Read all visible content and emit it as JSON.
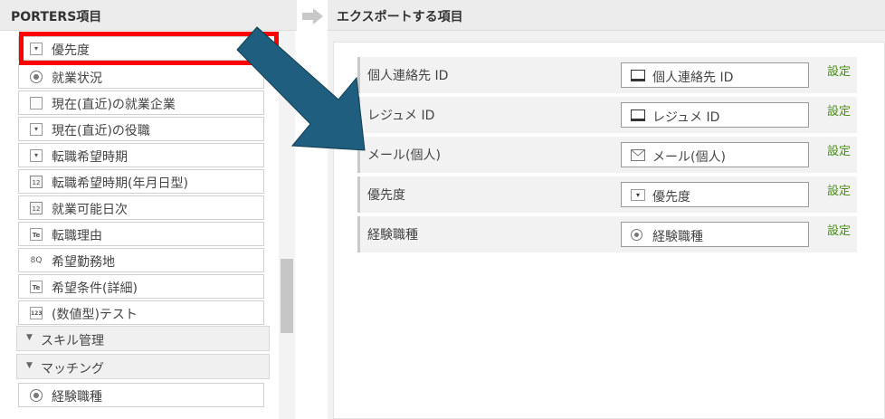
{
  "left_panel": {
    "title": "PORTERS項目",
    "items": [
      {
        "label": "優先度",
        "icon": "dropdown-icon"
      },
      {
        "label": "就業状況",
        "icon": "radio-icon"
      },
      {
        "label": "現在(直近)の就業企業",
        "icon": "document-icon"
      },
      {
        "label": "現在(直近)の役職",
        "icon": "dropdown-icon"
      },
      {
        "label": "転職希望時期",
        "icon": "dropdown-icon"
      },
      {
        "label": "転職希望時期(年月日型)",
        "icon": "calendar-icon"
      },
      {
        "label": "就業可能日次",
        "icon": "calendar-icon"
      },
      {
        "label": "転職理由",
        "icon": "textarea-icon"
      },
      {
        "label": "希望勤務地",
        "icon": "location-icon"
      },
      {
        "label": "希望条件(詳細)",
        "icon": "textarea-icon"
      },
      {
        "label": "(数値型)テスト",
        "icon": "number-icon"
      }
    ],
    "groups": [
      {
        "label": "スキル管理"
      },
      {
        "label": "マッチング"
      }
    ],
    "sub_items": [
      {
        "label": "経験職種",
        "icon": "radio-icon"
      }
    ]
  },
  "right_panel": {
    "title": "エクスポートする項目",
    "rows": [
      {
        "name": "個人連絡先 ID",
        "value": "個人連絡先 ID",
        "icon": "monitor-icon",
        "setting": "設定"
      },
      {
        "name": "レジュメ ID",
        "value": "レジュメ ID",
        "icon": "monitor-icon",
        "setting": "設定"
      },
      {
        "name": "メール(個人)",
        "value": "メール(個人)",
        "icon": "mail-icon",
        "setting": "設定"
      },
      {
        "name": "優先度",
        "value": "優先度",
        "icon": "dropdown-icon",
        "setting": "設定"
      },
      {
        "name": "経験職種",
        "value": "経験職種",
        "icon": "radio-icon",
        "setting": "設定"
      }
    ]
  },
  "icons": {
    "dropdown": "▾",
    "calendar": "12",
    "textarea": "Te",
    "number": "123",
    "location": "8Q"
  },
  "colors": {
    "highlight": "#ff0000",
    "arrow": "#1f5e7e",
    "setting_link": "#4a8a1a"
  }
}
